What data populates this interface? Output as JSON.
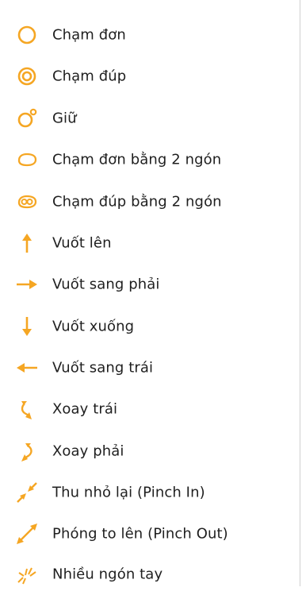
{
  "accent_color": "#F5A623",
  "menu": {
    "items": [
      {
        "label": "Chạm đơn",
        "icon": "tap-icon"
      },
      {
        "label": "Chạm đúp",
        "icon": "double-tap-icon"
      },
      {
        "label": "Giữ",
        "icon": "press-hold-icon"
      },
      {
        "label": "Chạm đơn bằng 2 ngón",
        "icon": "two-finger-tap-icon"
      },
      {
        "label": "Chạm đúp bằng 2 ngón",
        "icon": "two-finger-double-tap-icon"
      },
      {
        "label": "Vuốt lên",
        "icon": "swipe-up-icon"
      },
      {
        "label": "Vuốt sang phải",
        "icon": "swipe-right-icon"
      },
      {
        "label": "Vuốt xuống",
        "icon": "swipe-down-icon"
      },
      {
        "label": "Vuốt sang trái",
        "icon": "swipe-left-icon"
      },
      {
        "label": "Xoay trái",
        "icon": "rotate-left-icon"
      },
      {
        "label": "Xoay phải",
        "icon": "rotate-right-icon"
      },
      {
        "label": "Thu nhỏ lại  (Pinch In)",
        "icon": "pinch-in-icon"
      },
      {
        "label": "Phóng to lên (Pinch Out)",
        "icon": "pinch-out-icon"
      },
      {
        "label": "Nhiều ngón tay",
        "icon": "multi-finger-icon"
      }
    ]
  }
}
